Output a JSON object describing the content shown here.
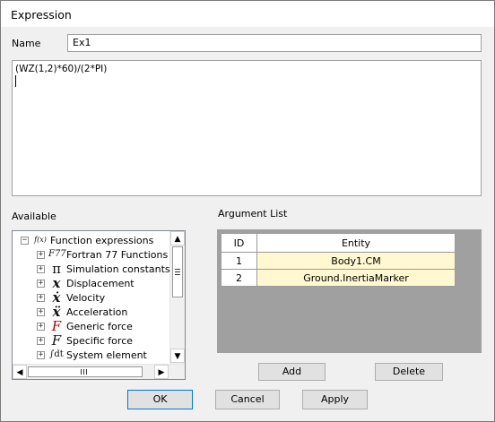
{
  "window": {
    "title": "Expression"
  },
  "name_field": {
    "label": "Name",
    "value": "Ex1"
  },
  "expression": {
    "text": "(WZ(1,2)*60)/(2*PI)"
  },
  "available": {
    "label": "Available",
    "root": {
      "label": "Function expressions",
      "icon_text": "f(x)"
    },
    "items": [
      {
        "label": "Fortran 77 Functions",
        "icon": "F77",
        "icon_name": "fortran-icon"
      },
      {
        "label": "Simulation constants",
        "icon": "π",
        "icon_name": "pi-icon"
      },
      {
        "label": "Displacement",
        "icon": "x",
        "icon_name": "displacement-icon"
      },
      {
        "label": "Velocity",
        "icon": "ẋ",
        "icon_name": "velocity-icon"
      },
      {
        "label": "Acceleration",
        "icon": "ẍ",
        "icon_name": "acceleration-icon"
      },
      {
        "label": "Generic force",
        "icon": "F",
        "icon_name": "generic-force-icon"
      },
      {
        "label": "Specific force",
        "icon": "F",
        "icon_name": "specific-force-icon"
      },
      {
        "label": "System element",
        "icon": "∫dt",
        "icon_name": "system-element-icon"
      }
    ],
    "hscroll_grip": "III"
  },
  "argument_list": {
    "label": "Argument List",
    "columns": [
      "ID",
      "Entity"
    ],
    "rows": [
      {
        "id": "1",
        "entity": "Body1.CM"
      },
      {
        "id": "2",
        "entity": "Ground.InertiaMarker"
      }
    ]
  },
  "buttons": {
    "add": "Add",
    "delete": "Delete",
    "ok": "OK",
    "cancel": "Cancel",
    "apply": "Apply"
  }
}
